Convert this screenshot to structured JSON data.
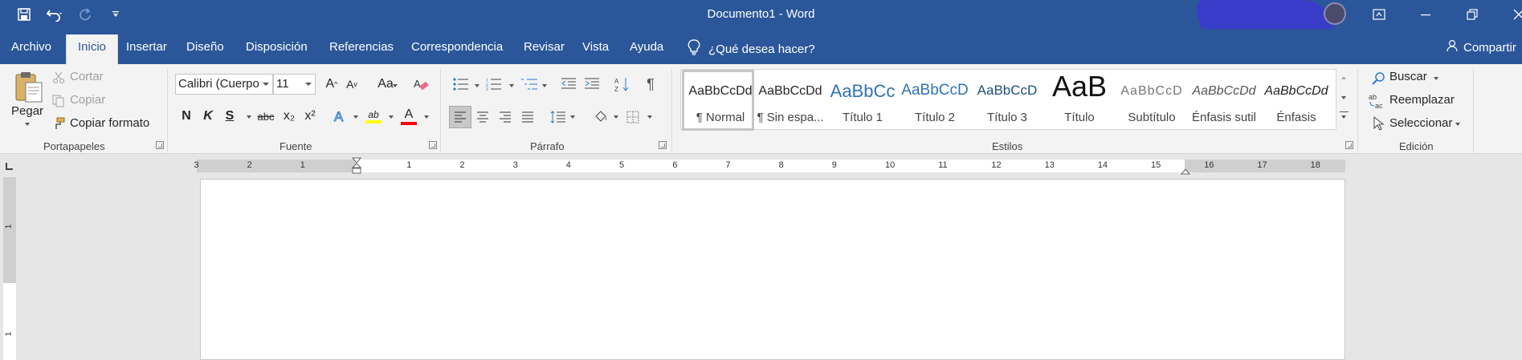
{
  "window": {
    "title": "Documento1  -  Word"
  },
  "quick_access": {
    "save_icon": "save-icon",
    "undo_icon": "undo-icon",
    "redo_icon": "redo-icon",
    "customize_icon": "customize-qat-icon"
  },
  "window_controls": [
    "ribbon-display-icon",
    "minimize-icon",
    "restore-icon",
    "close-icon"
  ],
  "tabs": [
    {
      "label": "Archivo"
    },
    {
      "label": "Inicio",
      "active": true
    },
    {
      "label": "Insertar"
    },
    {
      "label": "Diseño"
    },
    {
      "label": "Disposición"
    },
    {
      "label": "Referencias"
    },
    {
      "label": "Correspondencia"
    },
    {
      "label": "Revisar"
    },
    {
      "label": "Vista"
    },
    {
      "label": "Ayuda"
    }
  ],
  "tell_me": {
    "label": "¿Qué desea hacer?"
  },
  "share": {
    "label": "Compartir"
  },
  "ribbon": {
    "clipboard": {
      "label": "Portapapeles",
      "paste": "Pegar",
      "cut": "Cortar",
      "copy": "Copiar",
      "format_painter": "Copiar formato"
    },
    "font": {
      "label": "Fuente",
      "font_name": "Calibri (Cuerpo",
      "font_size": "11",
      "bold": "N",
      "italic": "K",
      "underline": "S",
      "strikethrough": "abc",
      "subscript": "x₂",
      "superscript": "x²",
      "change_case": "Aa",
      "grow": "A",
      "shrink": "A",
      "highlight": "ab",
      "font_color": "A"
    },
    "paragraph": {
      "label": "Párrafo",
      "pilcrow": "¶"
    },
    "styles": {
      "label": "Estilos",
      "items": [
        {
          "sample": "AaBbCcDd",
          "name": "¶ Normal",
          "selected": true
        },
        {
          "sample": "AaBbCcDd",
          "name": "¶ Sin espa..."
        },
        {
          "sample": "AaBbCc",
          "name": "Título 1"
        },
        {
          "sample": "AaBbCcD",
          "name": "Título 2"
        },
        {
          "sample": "AaBbCcD",
          "name": "Título 3"
        },
        {
          "sample": "AaB",
          "name": "Título"
        },
        {
          "sample": "AaBbCcD",
          "name": "Subtítulo"
        },
        {
          "sample": "AaBbCcDd",
          "name": "Énfasis sutil"
        },
        {
          "sample": "AaBbCcDd",
          "name": "Énfasis"
        }
      ]
    },
    "editing": {
      "label": "Edición",
      "find": "Buscar",
      "replace": "Reemplazar",
      "select": "Seleccionar"
    }
  },
  "ruler": {
    "numbers": [
      "3",
      "2",
      "1",
      "1",
      "2",
      "3",
      "4",
      "5",
      "6",
      "7",
      "8",
      "9",
      "10",
      "11",
      "12",
      "13",
      "14",
      "15",
      "16",
      "17",
      "18"
    ],
    "vertical_numbers": [
      "1",
      "1"
    ]
  },
  "colors": {
    "title_bar": "#2b579a",
    "ribbon": "#f3f3f3",
    "highlight": "#ffff00",
    "font_color": "#ff0000"
  }
}
